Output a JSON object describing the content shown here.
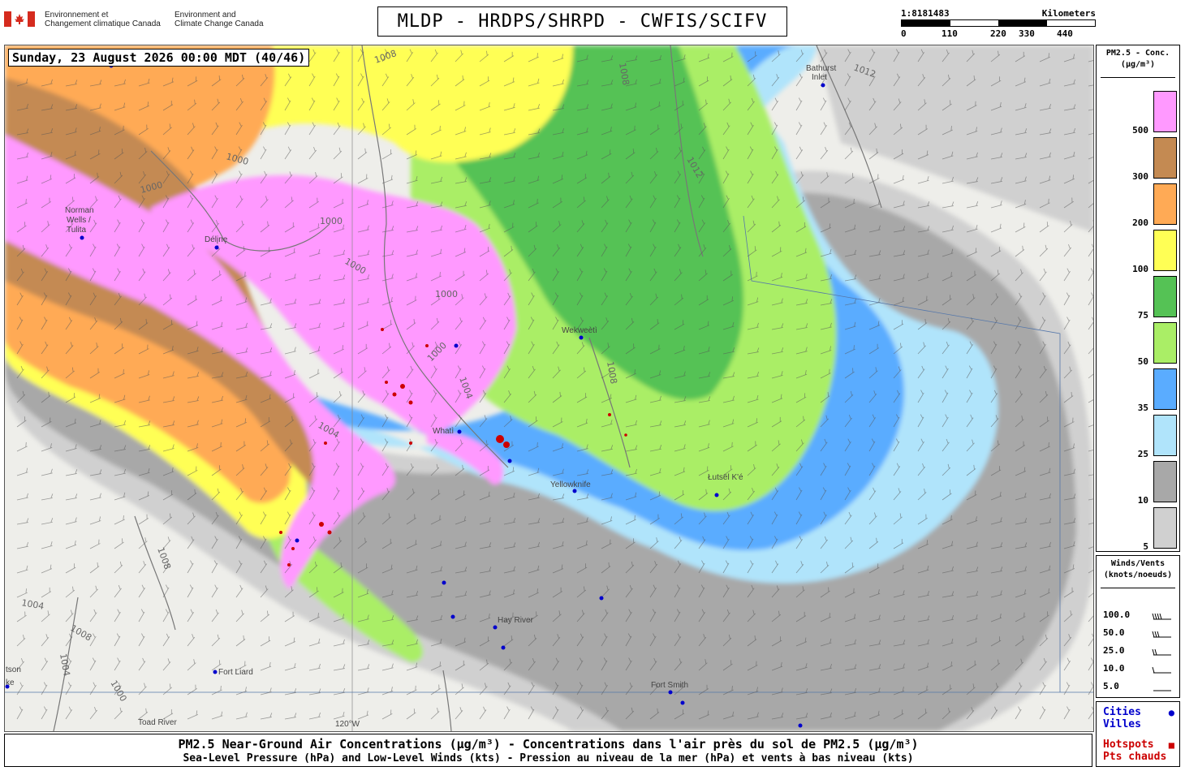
{
  "header": {
    "org_fr_line1": "Environnement et",
    "org_fr_line2": "Changement climatique Canada",
    "org_en_line1": "Environment and",
    "org_en_line2": "Climate Change Canada",
    "title": "MLDP - HRDPS/SHRPD - CWFIS/SCIFV",
    "scale_ratio": "1:8181483",
    "scale_unit": "Kilometers",
    "scale_ticks": [
      "0",
      "110",
      "220",
      "330",
      "440"
    ]
  },
  "map": {
    "timestamp": "Sunday, 23 August 2026 00:00 MDT (40/46)",
    "places": [
      {
        "name": "Norman",
        "key": "norman"
      },
      {
        "name": "Wells /",
        "key": "wells"
      },
      {
        "name": "Tulita",
        "key": "tulita"
      },
      {
        "name": "Délįnę",
        "key": "deline"
      },
      {
        "name": "Wekweètì",
        "key": "wekweeti"
      },
      {
        "name": "Whatì",
        "key": "whati"
      },
      {
        "name": "Yellowknife",
        "key": "yellowknife"
      },
      {
        "name": "Łutsël K'é",
        "key": "lutselke"
      },
      {
        "name": "Hay River",
        "key": "hayriver"
      },
      {
        "name": "Fort Liard",
        "key": "fortliard"
      },
      {
        "name": "Fort Smith",
        "key": "fortsmith"
      },
      {
        "name": "Bathurst",
        "key": "bathurst"
      },
      {
        "name": "Inlet",
        "key": "inlet"
      },
      {
        "name": "Toad River",
        "key": "toadriver"
      },
      {
        "name": "tson",
        "key": "tson"
      },
      {
        "name": "ke",
        "key": "ke"
      },
      {
        "name": "120°W",
        "key": "w120"
      }
    ],
    "isobars": [
      "1000",
      "1000",
      "1000",
      "1000",
      "1000",
      "1004",
      "1004",
      "1008",
      "1008",
      "1012",
      "1008",
      "1004",
      "1008",
      "1008",
      "1004",
      "1000",
      "1012",
      "1000"
    ],
    "colors": {
      "land": "#eeeeea",
      "lake": "#a9d2e4",
      "fire": "#cc0000",
      "city": "#0000cc"
    }
  },
  "legend_pm": {
    "title_line1": "PM2.5 - Conc.",
    "title_line2": "(µg/m³)",
    "levels": [
      {
        "label": "500",
        "color": "#ff99ff"
      },
      {
        "label": "300",
        "color": "#c48a52"
      },
      {
        "label": "200",
        "color": "#ffaa55"
      },
      {
        "label": "100",
        "color": "#ffff55"
      },
      {
        "label": "75",
        "color": "#55c255"
      },
      {
        "label": "50",
        "color": "#aaee66"
      },
      {
        "label": "35",
        "color": "#5aacff"
      },
      {
        "label": "25",
        "color": "#b0e4fb"
      },
      {
        "label": "10",
        "color": "#a8a8a8"
      },
      {
        "label": "5",
        "color": "#d0d0d0"
      }
    ]
  },
  "legend_wind": {
    "title_line1": "Winds/Vents",
    "title_line2": "(knots/noeuds)",
    "rows": [
      "100.0",
      "50.0",
      "25.0",
      "10.0",
      "5.0"
    ]
  },
  "legend_points": {
    "cities_en": "Cities",
    "cities_fr": "Villes",
    "hotspots_en": "Hotspots",
    "hotspots_fr": "Pts chauds",
    "city_color": "#0000cc",
    "hotspot_color": "#cc0000"
  },
  "footer": {
    "caption_1": "PM2.5 Near-Ground Air Concentrations (µg/m³) - Concentrations dans l'air près du sol de PM2.5 (µg/m³)",
    "caption_2": "Sea-Level Pressure (hPa) and Low-Level Winds (kts) - Pression au niveau de la mer (hPa) et vents à bas niveau (kts)"
  }
}
